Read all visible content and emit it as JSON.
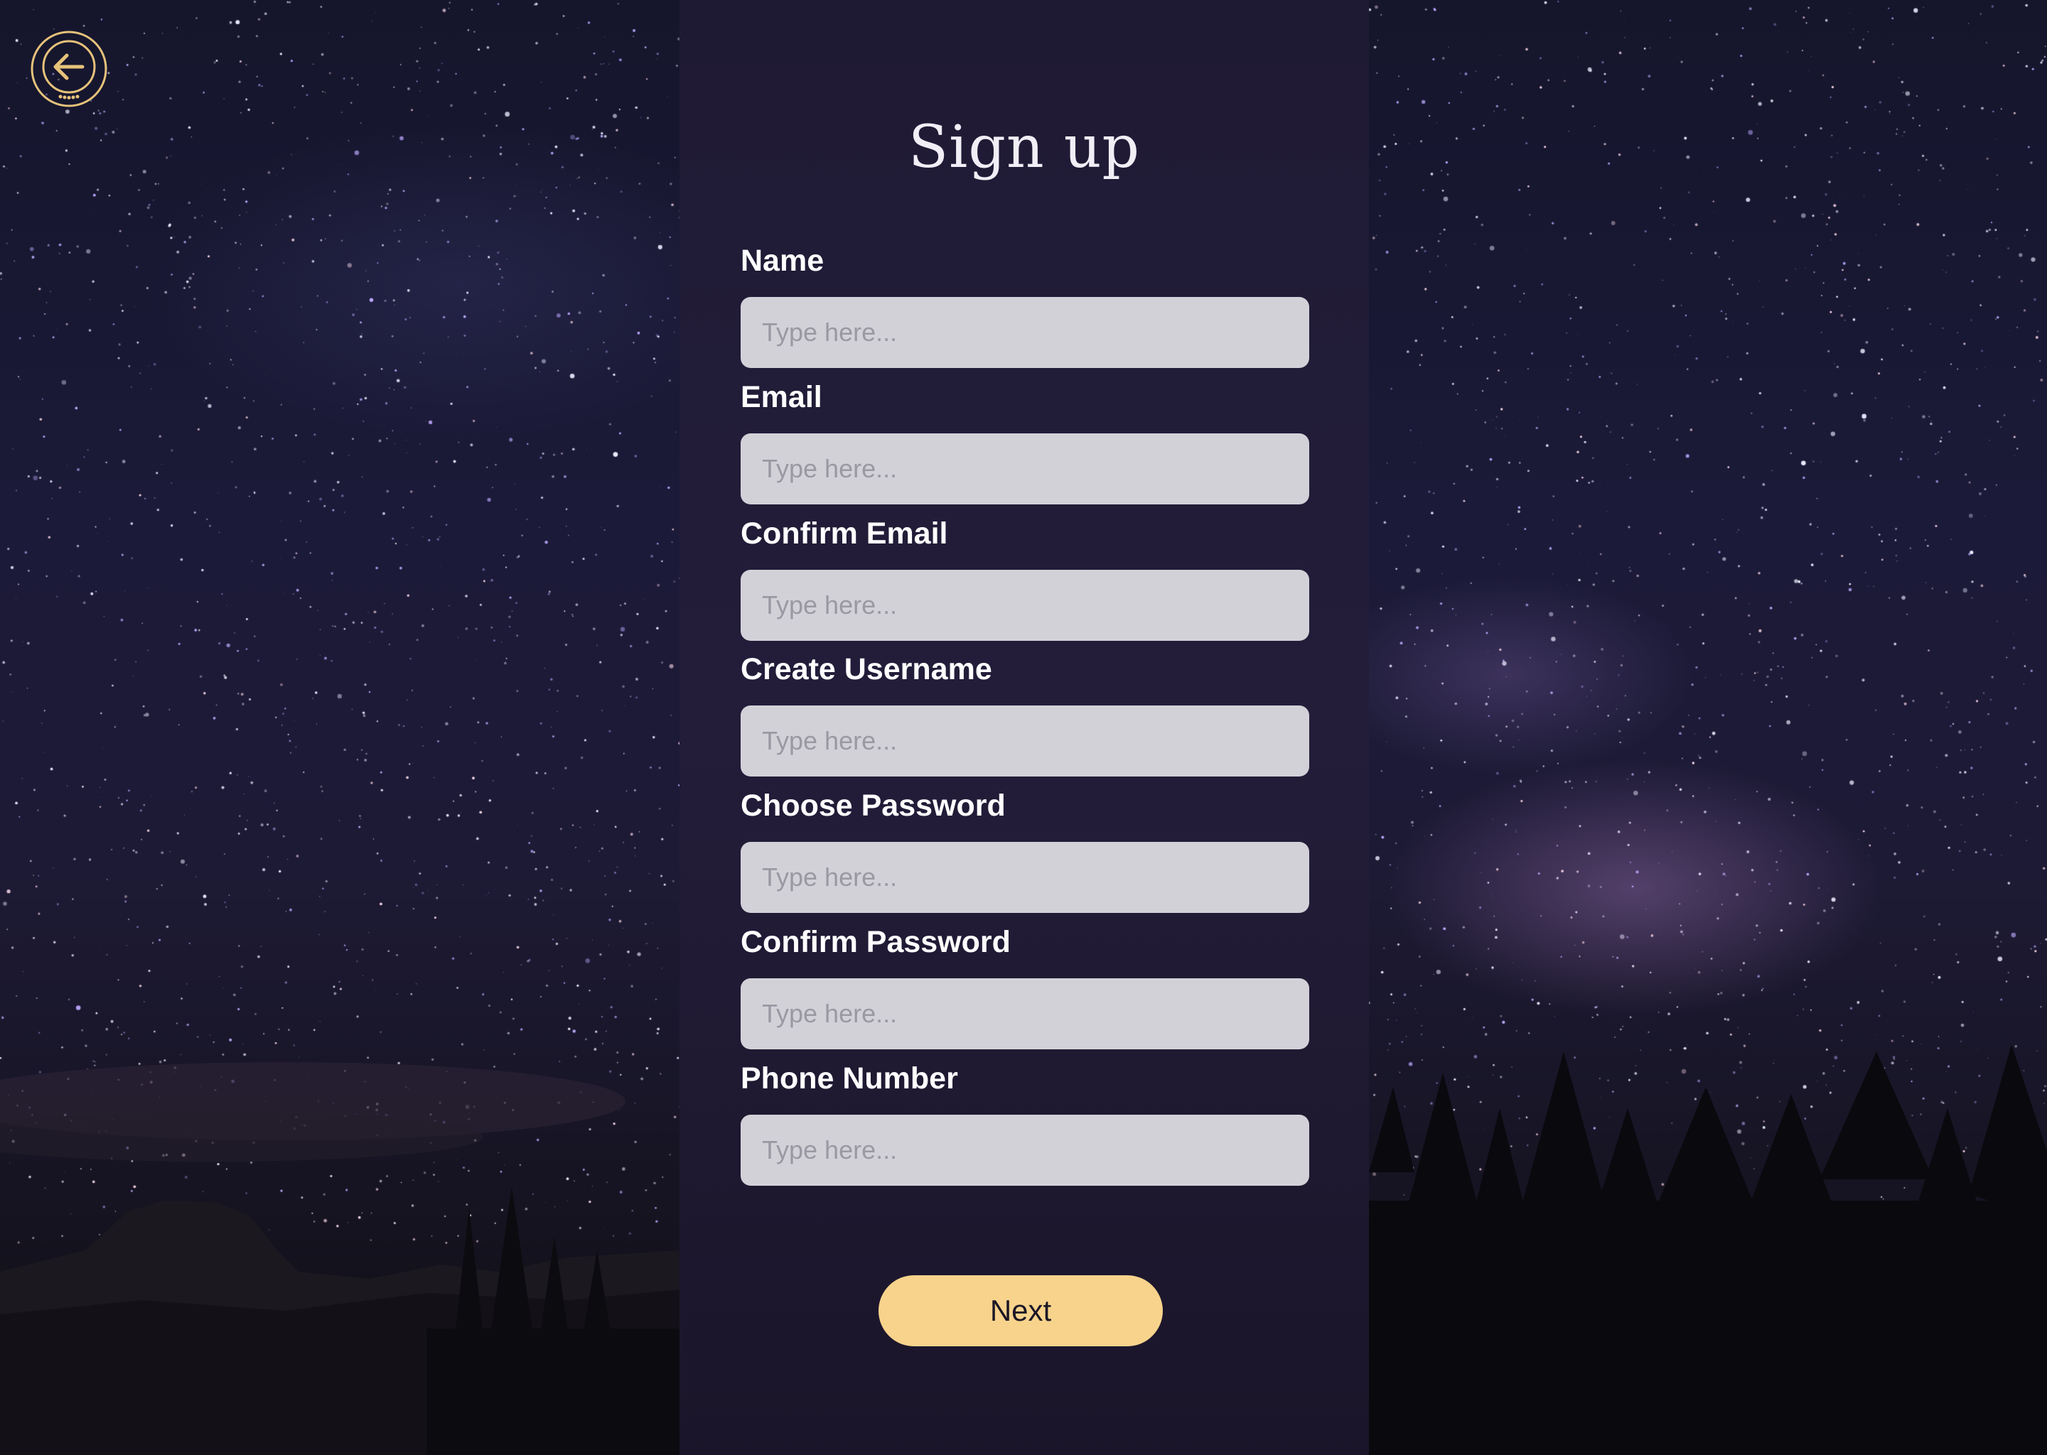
{
  "form": {
    "title": "Sign up",
    "fields": [
      {
        "label": "Name",
        "placeholder": "Type here..."
      },
      {
        "label": "Email",
        "placeholder": "Type here..."
      },
      {
        "label": "Confirm Email",
        "placeholder": "Type here..."
      },
      {
        "label": "Create Username",
        "placeholder": "Type here..."
      },
      {
        "label": "Choose Password",
        "placeholder": "Type here..."
      },
      {
        "label": "Confirm Password",
        "placeholder": "Type here..."
      },
      {
        "label": "Phone Number",
        "placeholder": "Type here..."
      }
    ],
    "next_label": "Next"
  },
  "colors": {
    "accent": "#f7d38c",
    "panel": "#221c38",
    "input_bg": "#d3d1d8",
    "back_icon": "#e6c27a"
  },
  "icons": {
    "back": "arrow-left-circle-icon"
  }
}
